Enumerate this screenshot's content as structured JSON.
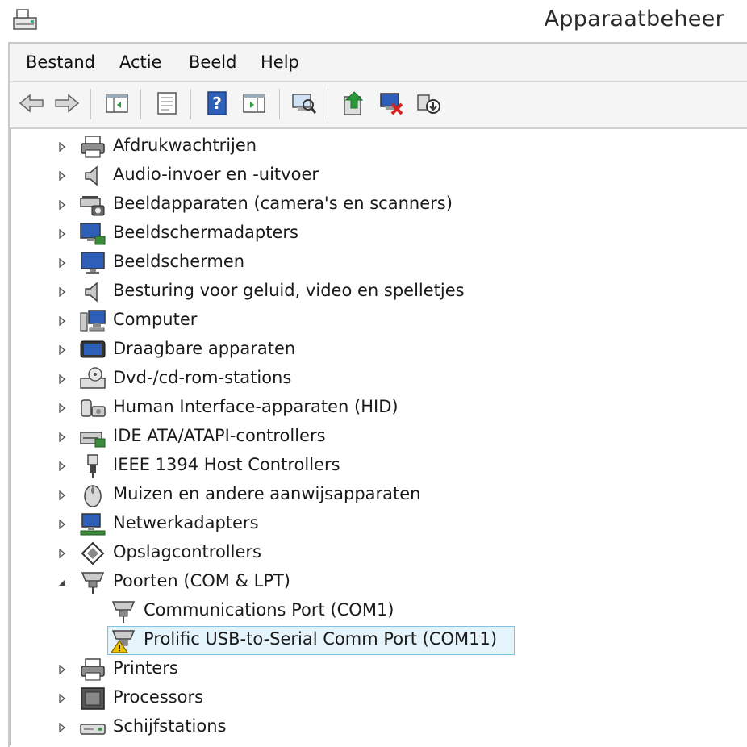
{
  "window": {
    "title": "Apparaatbeheer"
  },
  "menu": [
    "Bestand",
    "Actie",
    "Beeld",
    "Help"
  ],
  "toolbar": {
    "buttons": [
      {
        "name": "back-icon"
      },
      {
        "name": "forward-icon"
      },
      {
        "name": "show-hide-console-tree-icon"
      },
      {
        "name": "properties-icon"
      },
      {
        "name": "help-icon"
      },
      {
        "name": "action-pane-icon"
      },
      {
        "name": "scan-hardware-icon"
      },
      {
        "name": "update-driver-icon"
      },
      {
        "name": "uninstall-icon"
      },
      {
        "name": "disable-device-icon"
      }
    ]
  },
  "tree": {
    "categories": [
      {
        "label": "Afdrukwachtrijen",
        "icon": "printer-icon",
        "expanded": false
      },
      {
        "label": "Audio-invoer en -uitvoer",
        "icon": "speaker-icon",
        "expanded": false
      },
      {
        "label": "Beeldapparaten (camera's en scanners)",
        "icon": "scanner-camera-icon",
        "expanded": false
      },
      {
        "label": "Beeldschermadapters",
        "icon": "display-adapter-icon",
        "expanded": false
      },
      {
        "label": "Beeldschermen",
        "icon": "monitor-icon",
        "expanded": false
      },
      {
        "label": "Besturing voor geluid, video en spelletjes",
        "icon": "speaker-icon",
        "expanded": false
      },
      {
        "label": "Computer",
        "icon": "computer-icon",
        "expanded": false
      },
      {
        "label": "Draagbare apparaten",
        "icon": "portable-device-icon",
        "expanded": false
      },
      {
        "label": "Dvd-/cd-rom-stations",
        "icon": "optical-drive-icon",
        "expanded": false
      },
      {
        "label": "Human Interface-apparaten (HID)",
        "icon": "hid-icon",
        "expanded": false
      },
      {
        "label": "IDE ATA/ATAPI-controllers",
        "icon": "ide-controller-icon",
        "expanded": false
      },
      {
        "label": "IEEE 1394 Host Controllers",
        "icon": "firewire-icon",
        "expanded": false
      },
      {
        "label": "Muizen en andere aanwijsapparaten",
        "icon": "mouse-icon",
        "expanded": false
      },
      {
        "label": "Netwerkadapters",
        "icon": "network-adapter-icon",
        "expanded": false
      },
      {
        "label": "Opslagcontrollers",
        "icon": "storage-controller-icon",
        "expanded": false
      },
      {
        "label": "Poorten (COM & LPT)",
        "icon": "port-icon",
        "expanded": true,
        "children": [
          {
            "label": "Communications Port (COM1)",
            "icon": "port-icon",
            "warning": false,
            "selected": false
          },
          {
            "label": "Prolific USB-to-Serial Comm Port (COM11)",
            "icon": "port-warning-icon",
            "warning": true,
            "selected": true
          }
        ]
      },
      {
        "label": "Printers",
        "icon": "printer-icon",
        "expanded": false
      },
      {
        "label": "Processors",
        "icon": "processor-icon",
        "expanded": false
      },
      {
        "label": "Schijfstations",
        "icon": "disk-drive-icon",
        "expanded": false
      }
    ]
  },
  "colors": {
    "selection_bg": "#e5f3fb",
    "selection_border": "#7dc3e6",
    "warning": "#f2c200"
  }
}
